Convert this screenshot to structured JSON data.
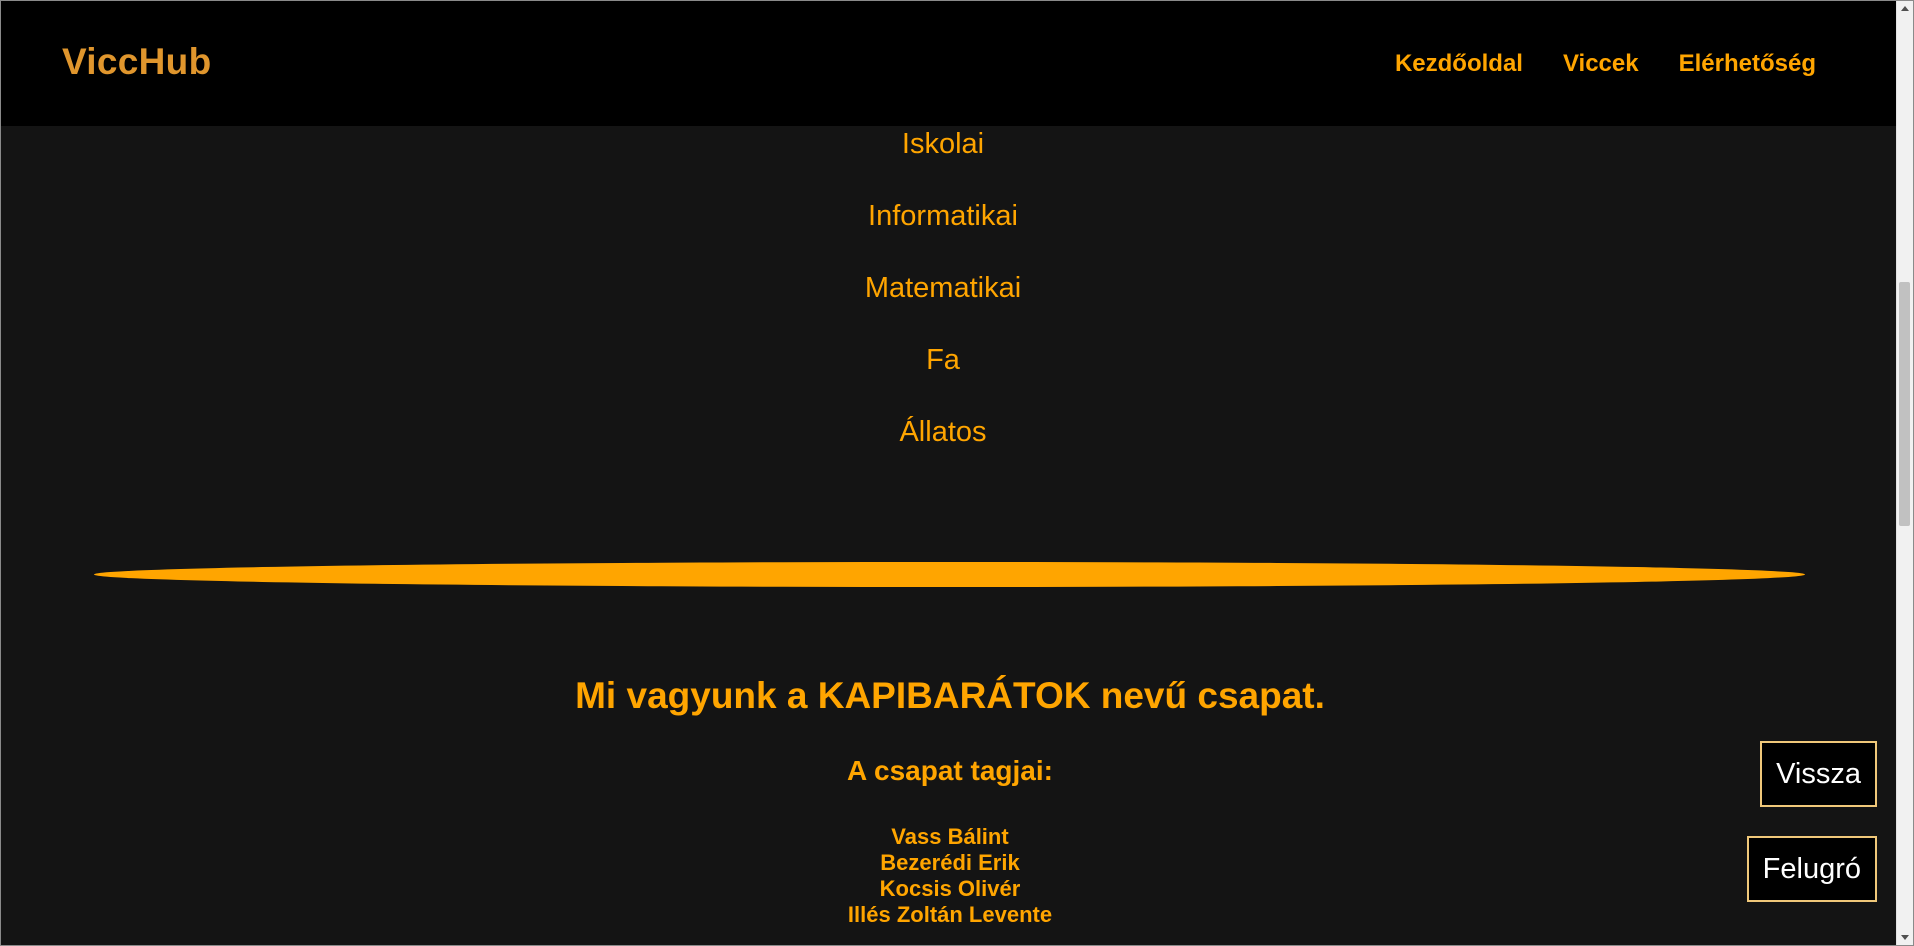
{
  "header": {
    "brand": "ViccHub",
    "nav": [
      "Kezdőoldal",
      "Viccek",
      "Elérhetőség"
    ]
  },
  "categories": [
    "Iskolai",
    "Informatikai",
    "Matematikai",
    "Fa",
    "Állatos"
  ],
  "team": {
    "title": "Mi vagyunk a KAPIBARÁTOK nevű csapat.",
    "subtitle": "A csapat tagjai:",
    "members": [
      "Vass Bálint",
      "Bezerédi Erik",
      "Kocsis Olivér",
      "Illés Zoltán Levente"
    ]
  },
  "buttons": {
    "back": "Vissza",
    "popup": "Felugró"
  },
  "colors": {
    "accent": "#ffa500",
    "brand": "#e0962d",
    "background": "#141414",
    "header_bg": "#000000"
  }
}
